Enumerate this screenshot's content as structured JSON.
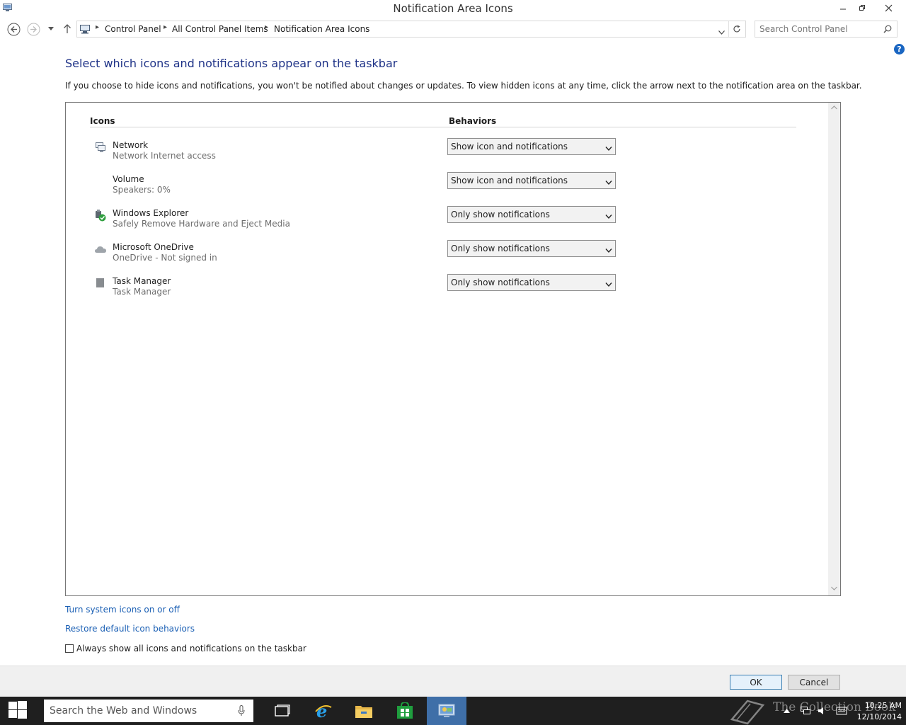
{
  "window": {
    "title": "Notification Area Icons"
  },
  "address": {
    "crumbs": [
      "Control Panel",
      "All Control Panel Items",
      "Notification Area Icons"
    ],
    "search_placeholder": "Search Control Panel"
  },
  "main": {
    "heading": "Select which icons and notifications appear on the taskbar",
    "description": "If you choose to hide icons and notifications, you won't be notified about changes or updates. To view hidden icons at any time, click the arrow next to the notification area on the taskbar.",
    "columns": {
      "icons": "Icons",
      "behaviors": "Behaviors"
    },
    "rows": [
      {
        "icon": "network-icon",
        "title": "Network",
        "subtitle": "Network Internet access",
        "behavior": "Show icon and notifications"
      },
      {
        "icon": "volume-icon",
        "title": "Volume",
        "subtitle": "Speakers: 0%",
        "behavior": "Show icon and notifications"
      },
      {
        "icon": "safely-remove-hardware-icon",
        "title": "Windows Explorer",
        "subtitle": "Safely Remove Hardware and Eject Media",
        "behavior": "Only show notifications"
      },
      {
        "icon": "onedrive-cloud-icon",
        "title": "Microsoft OneDrive",
        "subtitle": "OneDrive - Not signed in",
        "behavior": "Only show notifications"
      },
      {
        "icon": "task-manager-icon",
        "title": "Task Manager",
        "subtitle": "Task Manager",
        "behavior": "Only show notifications"
      }
    ],
    "links": {
      "system_icons": "Turn system icons on or off",
      "restore_defaults": "Restore default icon behaviors"
    },
    "always_show": {
      "label": "Always show all icons and notifications on the taskbar",
      "checked": false
    }
  },
  "footer": {
    "ok_label": "OK",
    "cancel_label": "Cancel"
  },
  "taskbar": {
    "search_placeholder": "Search the Web and Windows",
    "apps": [
      "task-view-icon",
      "internet-explorer-icon",
      "file-explorer-icon",
      "store-icon",
      "control-panel-icon"
    ],
    "active_app": "control-panel-icon",
    "clock_time": "10:25 AM",
    "clock_date": "12/10/2014",
    "watermark": "The Collection Book"
  },
  "colors": {
    "heading": "#1e3287",
    "link": "#1a5fb4",
    "taskbar": "#1f1f1f",
    "active_app": "#3f6fa8"
  }
}
